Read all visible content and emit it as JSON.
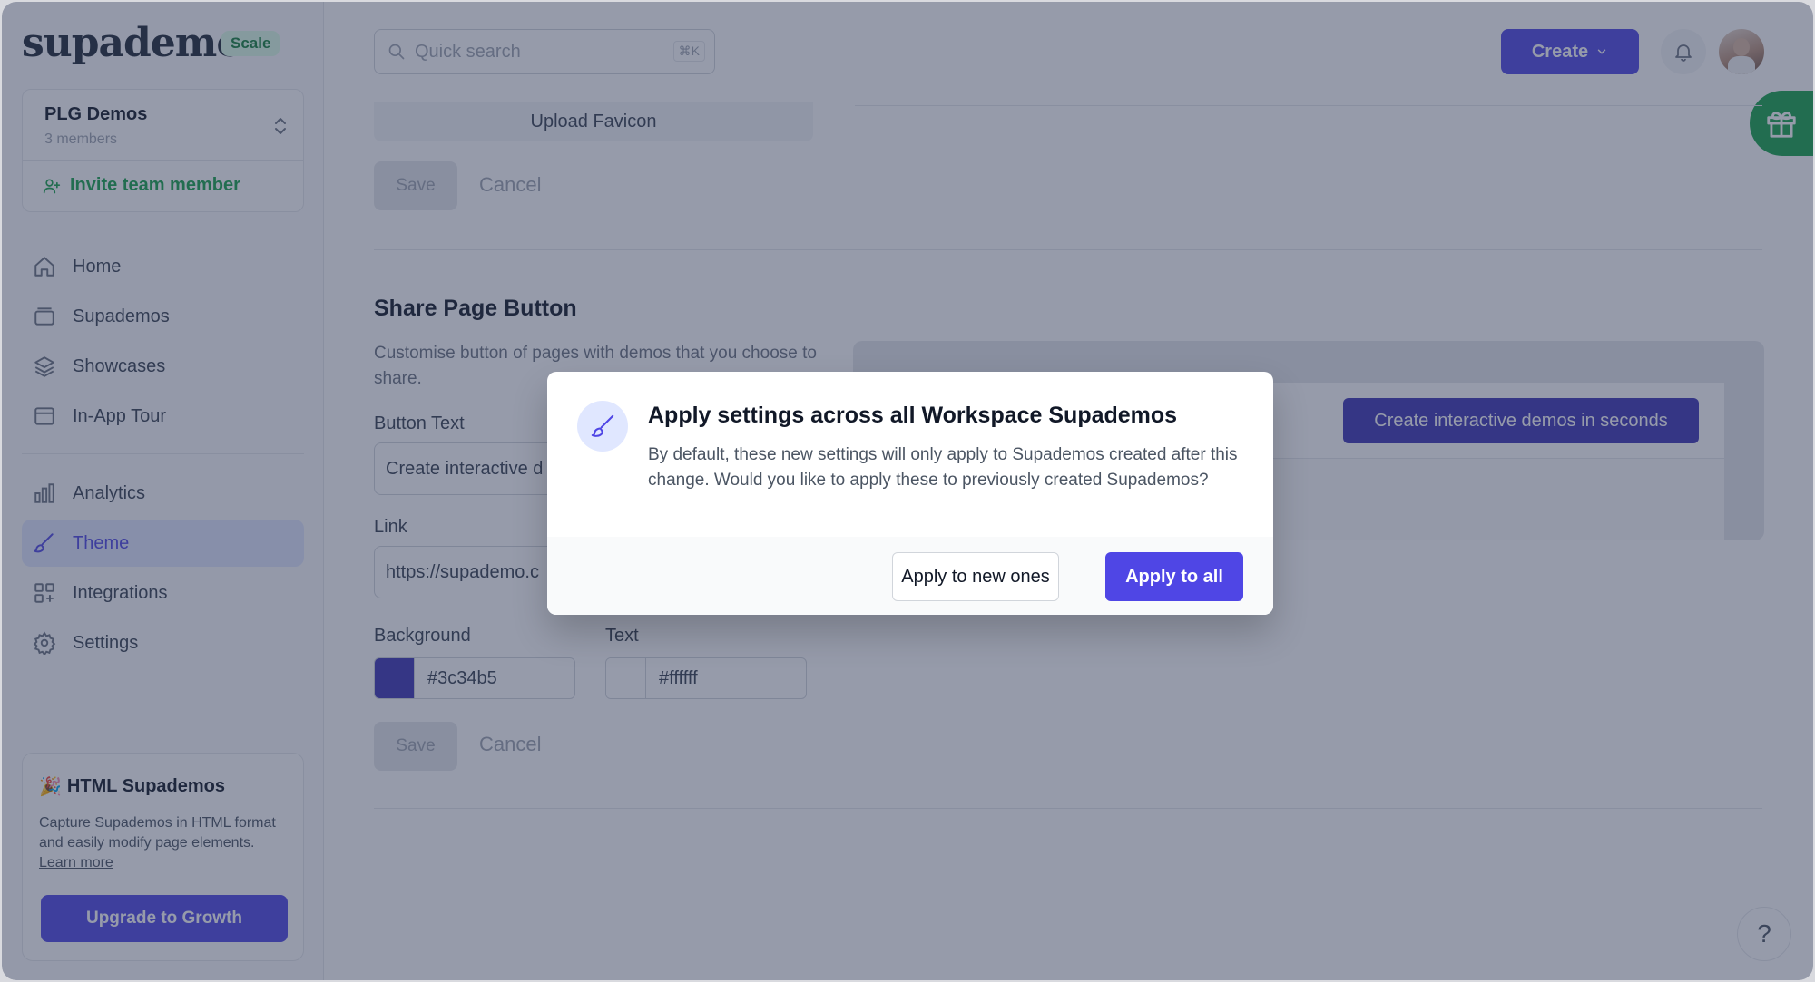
{
  "brand": {
    "logo": "supademo",
    "plan_badge": "Scale"
  },
  "workspace": {
    "name": "PLG Demos",
    "members": "3 members",
    "invite_label": "Invite team member"
  },
  "nav": {
    "home": "Home",
    "supademos": "Supademos",
    "showcases": "Showcases",
    "in_app_tour": "In-App Tour",
    "analytics": "Analytics",
    "theme": "Theme",
    "integrations": "Integrations",
    "settings": "Settings",
    "active": "Theme"
  },
  "promo": {
    "emoji": "🎉",
    "title": "HTML Supademos",
    "text": "Capture Supademos in HTML format and easily modify page elements.",
    "link": "Learn more",
    "button": "Upgrade to Growth"
  },
  "topbar": {
    "search_placeholder": "Quick search",
    "search_shortcut": "⌘K",
    "create_label": "Create"
  },
  "favicon_section": {
    "upload_label": "Upload Favicon",
    "save_label": "Save",
    "cancel_label": "Cancel"
  },
  "share_button_section": {
    "title": "Share Page Button",
    "description": "Customise button of pages with demos that you choose to share.",
    "button_text_label": "Button Text",
    "button_text_value": "Create interactive d",
    "link_label": "Link",
    "link_value": "https://supademo.c",
    "background_label": "Background",
    "background_value": "#3c34b5",
    "text_color_label": "Text",
    "text_color_value": "#ffffff",
    "save_label": "Save",
    "cancel_label": "Cancel",
    "preview_button": "Create interactive demos in seconds"
  },
  "modal": {
    "title": "Apply settings across all Workspace Supademos",
    "body": "By default, these new settings will only apply to Supademos created after this change. Would you like to apply these to previously created Supademos?",
    "secondary_button": "Apply to new ones",
    "primary_button": "Apply to all"
  },
  "help": {
    "label": "?"
  },
  "colors": {
    "accent": "#4f46e5",
    "brand_green": "#16a34a",
    "preview_button_bg": "#3c34b5",
    "preview_button_text": "#ffffff",
    "overlay": "rgba(45,55,85,0.5)"
  },
  "icons": {
    "nav": [
      "home-icon",
      "supademos-icon",
      "showcases-icon",
      "in-app-tour-icon",
      "analytics-icon",
      "theme-brush-icon",
      "integrations-icon",
      "settings-gear-icon"
    ],
    "modal": "paintbrush-icon",
    "topbar": [
      "search-icon",
      "chevron-down-icon",
      "bell-icon",
      "avatar",
      "gift-icon"
    ]
  }
}
